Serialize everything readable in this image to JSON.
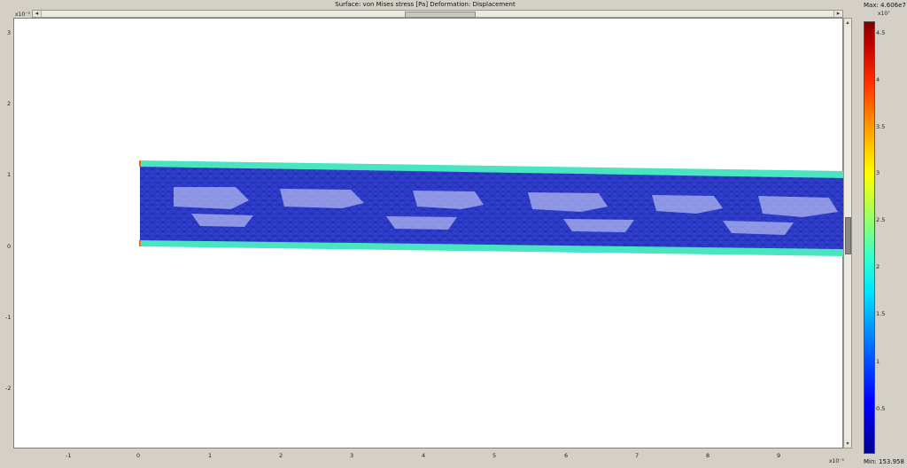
{
  "plot": {
    "title": "Surface: von Mises stress [Pa]   Deformation: Displacement",
    "x_axis": {
      "ticks": [
        "-1",
        "0",
        "1",
        "2",
        "3",
        "4",
        "5",
        "6",
        "7",
        "8",
        "9"
      ],
      "exponent_label": "x10⁻³"
    },
    "y_axis": {
      "ticks": [
        "3",
        "2",
        "1",
        "0",
        "-1",
        "-2"
      ],
      "exponent_label": "x10⁻³"
    }
  },
  "colorbar": {
    "max_label": "Max: 4.606e7",
    "min_label": "Min: 153.958",
    "exponent_label": "x10⁷",
    "ticks": [
      "4.5",
      "4",
      "3.5",
      "3",
      "2.5",
      "2",
      "1.5",
      "1",
      "0.5"
    ]
  },
  "scrollbars": {
    "left_arrow": "◂",
    "right_arrow": "▸",
    "up_arrow": "▴",
    "down_arrow": "▾"
  },
  "colors": {
    "mesh_fill": "#2f3fd0",
    "mesh_line": "#1a1a8c",
    "edge_stress": "#49e4c0",
    "edge_hot": "#ff6a00"
  }
}
